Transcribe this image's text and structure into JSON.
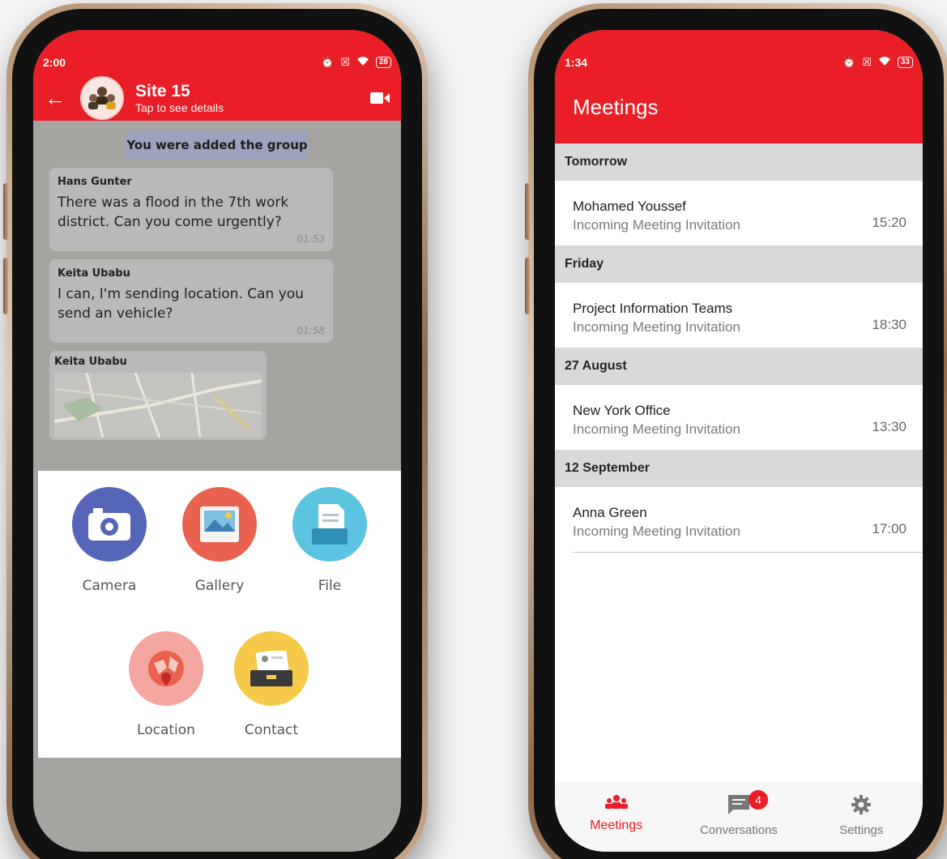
{
  "chat": {
    "status_time": "2:00",
    "battery": "28",
    "group_name": "Site 15",
    "group_subtitle": "Tap to see details",
    "system_message": "You were added the group",
    "messages": [
      {
        "sender": "Hans Gunter",
        "text": "There was a flood in the 7th work district. Can you come urgently?",
        "time": "01:53"
      },
      {
        "sender": "Keita Ubabu",
        "text": "I can, I'm sending location. Can you send an vehicle?",
        "time": "01:58"
      }
    ],
    "location_message_sender": "Keita Ubabu",
    "attachments": [
      {
        "label": "Camera",
        "icon": "camera-icon",
        "color": "#5566b8"
      },
      {
        "label": "Gallery",
        "icon": "gallery-icon",
        "color": "#e8624f"
      },
      {
        "label": "File",
        "icon": "file-icon",
        "color": "#5bc4e0"
      },
      {
        "label": "Location",
        "icon": "location-icon",
        "color": "#f4a6a0"
      },
      {
        "label": "Contact",
        "icon": "contact-icon",
        "color": "#f6c94a"
      }
    ]
  },
  "meetings": {
    "status_time": "1:34",
    "battery": "33",
    "title": "Meetings",
    "sections": [
      {
        "header": "Tomorrow",
        "name": "Mohamed Youssef",
        "desc": "Incoming Meeting Invitation",
        "time": "15:20"
      },
      {
        "header": "Friday",
        "name": "Project Information Teams",
        "desc": "Incoming Meeting Invitation",
        "time": "18:30"
      },
      {
        "header": "27 August",
        "name": "New York Office",
        "desc": "Incoming Meeting Invitation",
        "time": "13:30"
      },
      {
        "header": "12 September",
        "name": "Anna Green",
        "desc": "Incoming Meeting Invitation",
        "time": "17:00"
      }
    ],
    "nav": {
      "meetings": "Meetings",
      "conversations": "Conversations",
      "conversations_badge": "4",
      "settings": "Settings"
    }
  },
  "colors": {
    "brand_red": "#e91e26"
  }
}
